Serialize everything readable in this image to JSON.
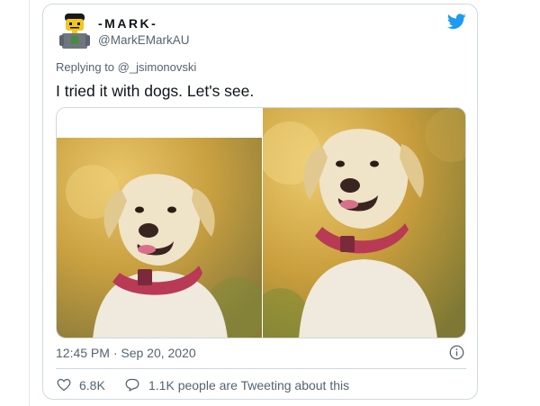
{
  "author": {
    "display_name": "-MARK-",
    "handle": "@MarkEMarkAU",
    "avatar_icon": "lego-figure-avatar"
  },
  "brand": {
    "icon": "twitter-bird-icon",
    "color": "#1d9bf0"
  },
  "reply_context": {
    "prefix": "Replying to",
    "mention": "@_jsimonovski"
  },
  "tweet": {
    "text": "I tried it with dogs. Let's see."
  },
  "media": {
    "images": [
      {
        "subject": "yellow-labrador-photo-cropped"
      },
      {
        "subject": "yellow-labrador-photo-full"
      }
    ]
  },
  "meta": {
    "timestamp": "12:45 PM · Sep 20, 2020",
    "info_icon": "info-icon"
  },
  "actions": {
    "likes": {
      "icon": "heart-icon",
      "count": "6.8K"
    },
    "replies": {
      "icon": "comment-icon",
      "label": "1.1K people are Tweeting about this"
    }
  },
  "colors": {
    "secondary_text": "#536471",
    "border": "#cfd9de"
  }
}
